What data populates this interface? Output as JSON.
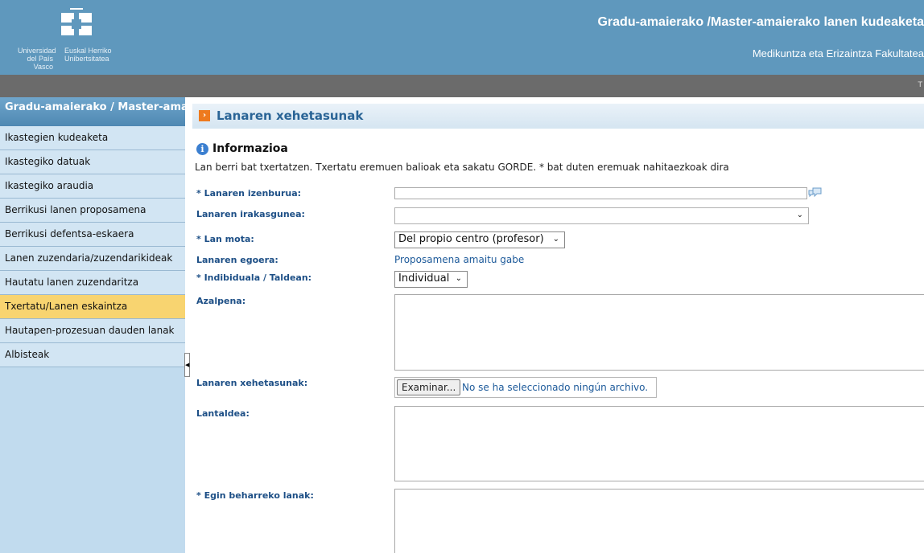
{
  "header": {
    "logo": {
      "university_es": [
        "Universidad",
        "del País Vasco"
      ],
      "university_eu": [
        "Euskal Herriko",
        "Unibertsitatea"
      ]
    },
    "app_title": "Gradu-amaierako /Master-amaierako lanen kudeaketa",
    "faculty": "Medikuntza eta Erizaintza Fakultatea",
    "greybar_marker": "T"
  },
  "sidebar": {
    "heading": "Gradu-amaierako / Master-amaierako lanak",
    "items": [
      {
        "label": "Ikastegien kudeaketa",
        "active": false
      },
      {
        "label": "Ikastegiko datuak",
        "active": false
      },
      {
        "label": "Ikastegiko araudia",
        "active": false
      },
      {
        "label": "Berrikusi lanen proposamena",
        "active": false
      },
      {
        "label": "Berrikusi defentsa-eskaera",
        "active": false
      },
      {
        "label": "Lanen zuzendaria/zuzendarikideak",
        "active": false
      },
      {
        "label": "Hautatu lanen zuzendaritza",
        "active": false
      },
      {
        "label": "Txertatu/Lanen eskaintza",
        "active": true
      },
      {
        "label": "Hautapen-prozesuan dauden lanak",
        "active": false
      },
      {
        "label": "Albisteak",
        "active": false
      }
    ]
  },
  "main": {
    "section_title": "Lanaren xehetasunak",
    "info": {
      "title": "Informazioa",
      "text": "Lan berri bat txertatzen. Txertatu eremuen balioak eta sakatu GORDE. * bat duten eremuak nahitaezkoak dira"
    },
    "form": {
      "title_label": "* Lanaren izenburua:",
      "title_value": "",
      "department_label": "Lanaren irakasgunea:",
      "department_value": "",
      "type_label": "* Lan mota:",
      "type_value": "Del propio centro (profesor)",
      "status_label": "Lanaren egoera:",
      "status_value": "Proposamena amaitu gabe",
      "mode_label": "* Indibiduala / Taldean:",
      "mode_value": "Individual",
      "description_label": "Azalpena:",
      "description_value": "",
      "details_label": "Lanaren xehetasunak:",
      "file_button": "Examinar...",
      "file_status": "No se ha seleccionado ningún archivo.",
      "team_label": "Lantaldea:",
      "team_value": "",
      "tasks_label": "* Egin beharreko lanak:",
      "tasks_value": ""
    }
  },
  "colors": {
    "header_bg": "#5f98bd",
    "greybar_bg": "#6b6b6b",
    "sidebar_bg": "#c1dbee",
    "active_item": "#f8d470",
    "label_color": "#1d4f86",
    "section_icon": "#ee7a1e"
  }
}
